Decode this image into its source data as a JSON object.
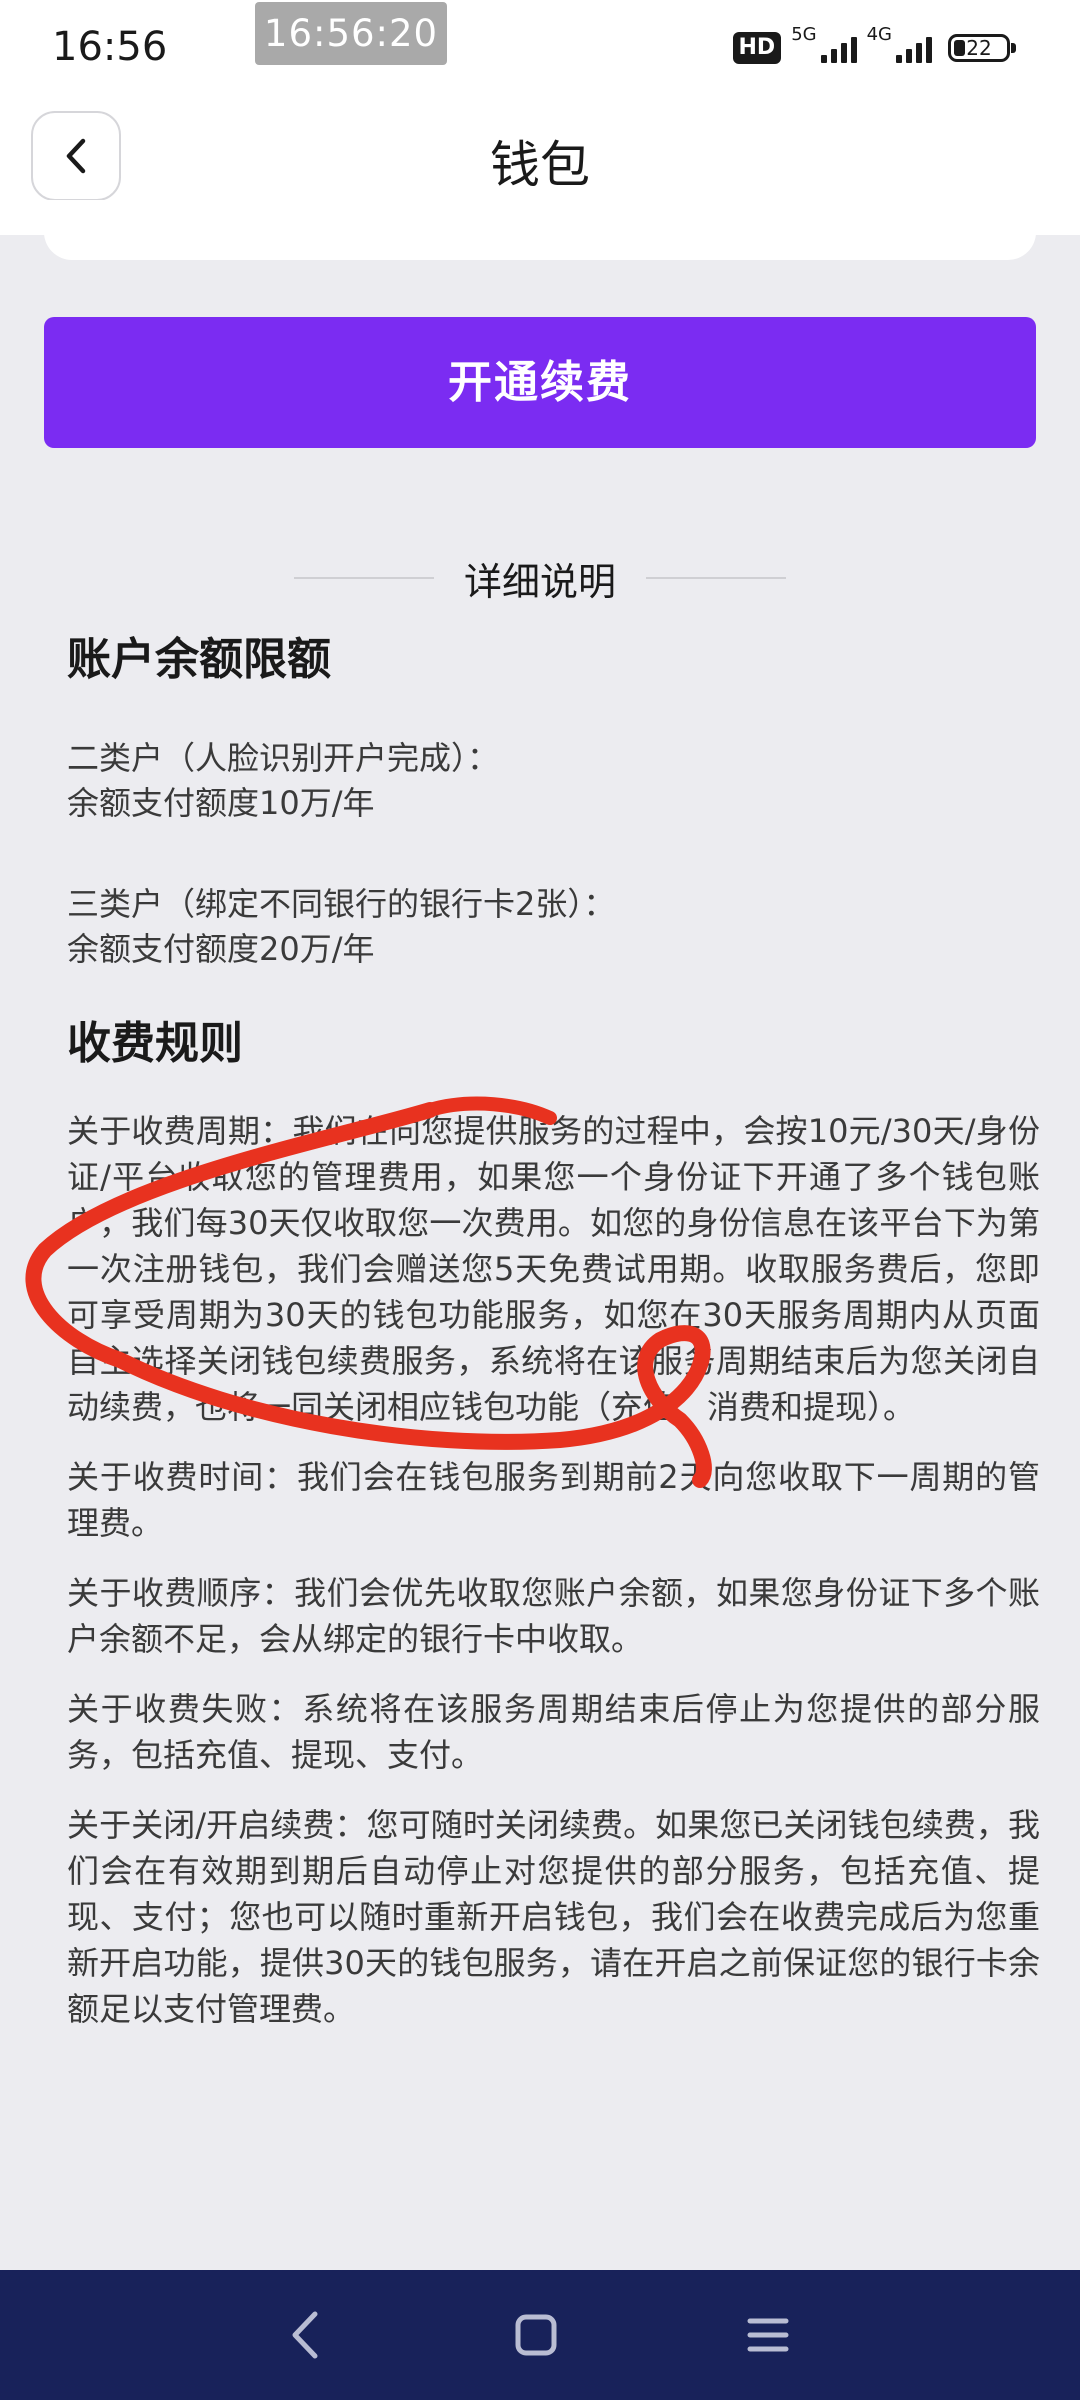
{
  "status_bar": {
    "time": "16:56",
    "toast_time": "16:56:20",
    "hd_label": "HD",
    "net1": "5G",
    "net2": "4G",
    "battery": "22",
    "battery_level": 0.22
  },
  "header": {
    "title": "钱包",
    "back_icon": "chevron-left-icon"
  },
  "renew_button": "开通续费",
  "section_divider": "详细说明",
  "limits": {
    "title": "账户余额限额",
    "items": [
      {
        "type": "二类户（人脸识别开户完成）：",
        "quota": "余额支付额度10万/年"
      },
      {
        "type": "三类户（绑定不同银行的银行卡2张）：",
        "quota": "余额支付额度20万/年"
      }
    ]
  },
  "fees": {
    "title": "收费规则",
    "paragraphs": [
      "关于收费周期：我们在向您提供服务的过程中，会按10元/30天/身份证/平台收取您的管理费用，如果您一个身份证下开通了多个钱包账户，我们每30天仅收取您一次费用。如您的身份信息在该平台下为第一次注册钱包，我们会赠送您5天免费试用期。收取服务费后，您即可享受周期为30天的钱包功能服务，如您在30天服务周期内从页面自主选择关闭钱包续费服务，系统将在该服务周期结束后为您关闭自动续费，也将一同关闭相应钱包功能（充值、消费和提现）。",
      "关于收费时间：我们会在钱包服务到期前2天向您收取下一周期的管理费。",
      "关于收费顺序：我们会优先收取您账户余额，如果您身份证下多个账户余额不足，会从绑定的银行卡中收取。",
      "关于收费失败：系统将在该服务周期结束后停止为您提供的部分服务，包括充值、提现、支付。",
      "关于关闭/开启续费：您可随时关闭续费。如果您已关闭钱包续费，我们会在有效期到期后自动停止对您提供的部分服务，包括充值、提现、支付；您也可以随时重新开启钱包，我们会在收费完成后为您重新开启功能，提供30天的钱包服务，请在开启之前保证您的银行卡余额足以支付管理费。"
    ]
  },
  "nav": {
    "back_icon": "triangle-back-icon",
    "home_icon": "square-home-icon",
    "menu_icon": "hamburger-menu-icon"
  },
  "colors": {
    "accent": "#7b2cf2",
    "background": "#ececf0",
    "navbar": "#18225a",
    "annotation": "#e8321f"
  }
}
